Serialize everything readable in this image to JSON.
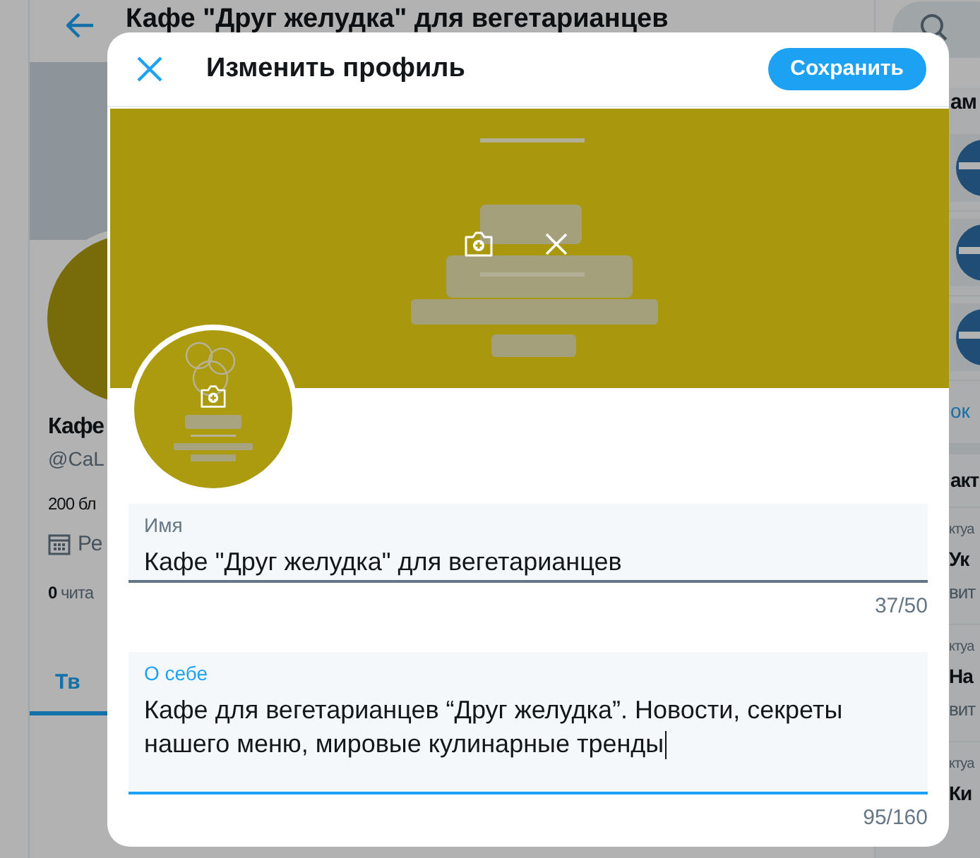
{
  "background_page": {
    "header_title": "Кафе \"Друг желудка\" для вегетарианцев",
    "profile": {
      "name": "Кафе",
      "handle": "@CaL",
      "bio": "200 бл",
      "joined": "Ре",
      "followers": "**0** чита",
      "tabs": [
        {
          "label": "Тв",
          "selected": true
        }
      ]
    },
    "sidebar": {
      "heading": "ам",
      "more_link": "ок",
      "trends_heading": "акт",
      "trends": [
        {
          "category": "ктуа",
          "title": "Ук",
          "meta": "вит"
        },
        {
          "category": "ктуа",
          "title": "На",
          "meta": "вит"
        },
        {
          "category": "ктуа",
          "title": "Ки"
        }
      ]
    }
  },
  "modal": {
    "title": "Изменить профиль",
    "save_button": "Сохранить",
    "fields": [
      {
        "label": "Имя",
        "value": "Кафе \"Друг желудка\" для вегетарианцев",
        "counter": "37/50",
        "focused": false
      },
      {
        "label": "О себе",
        "value": "Кафе для вегетарианцев “Друг желудка”. Новости, секреты нашего меню, мировые кулинарные тренды",
        "counter": "95/160",
        "focused": true
      }
    ]
  }
}
